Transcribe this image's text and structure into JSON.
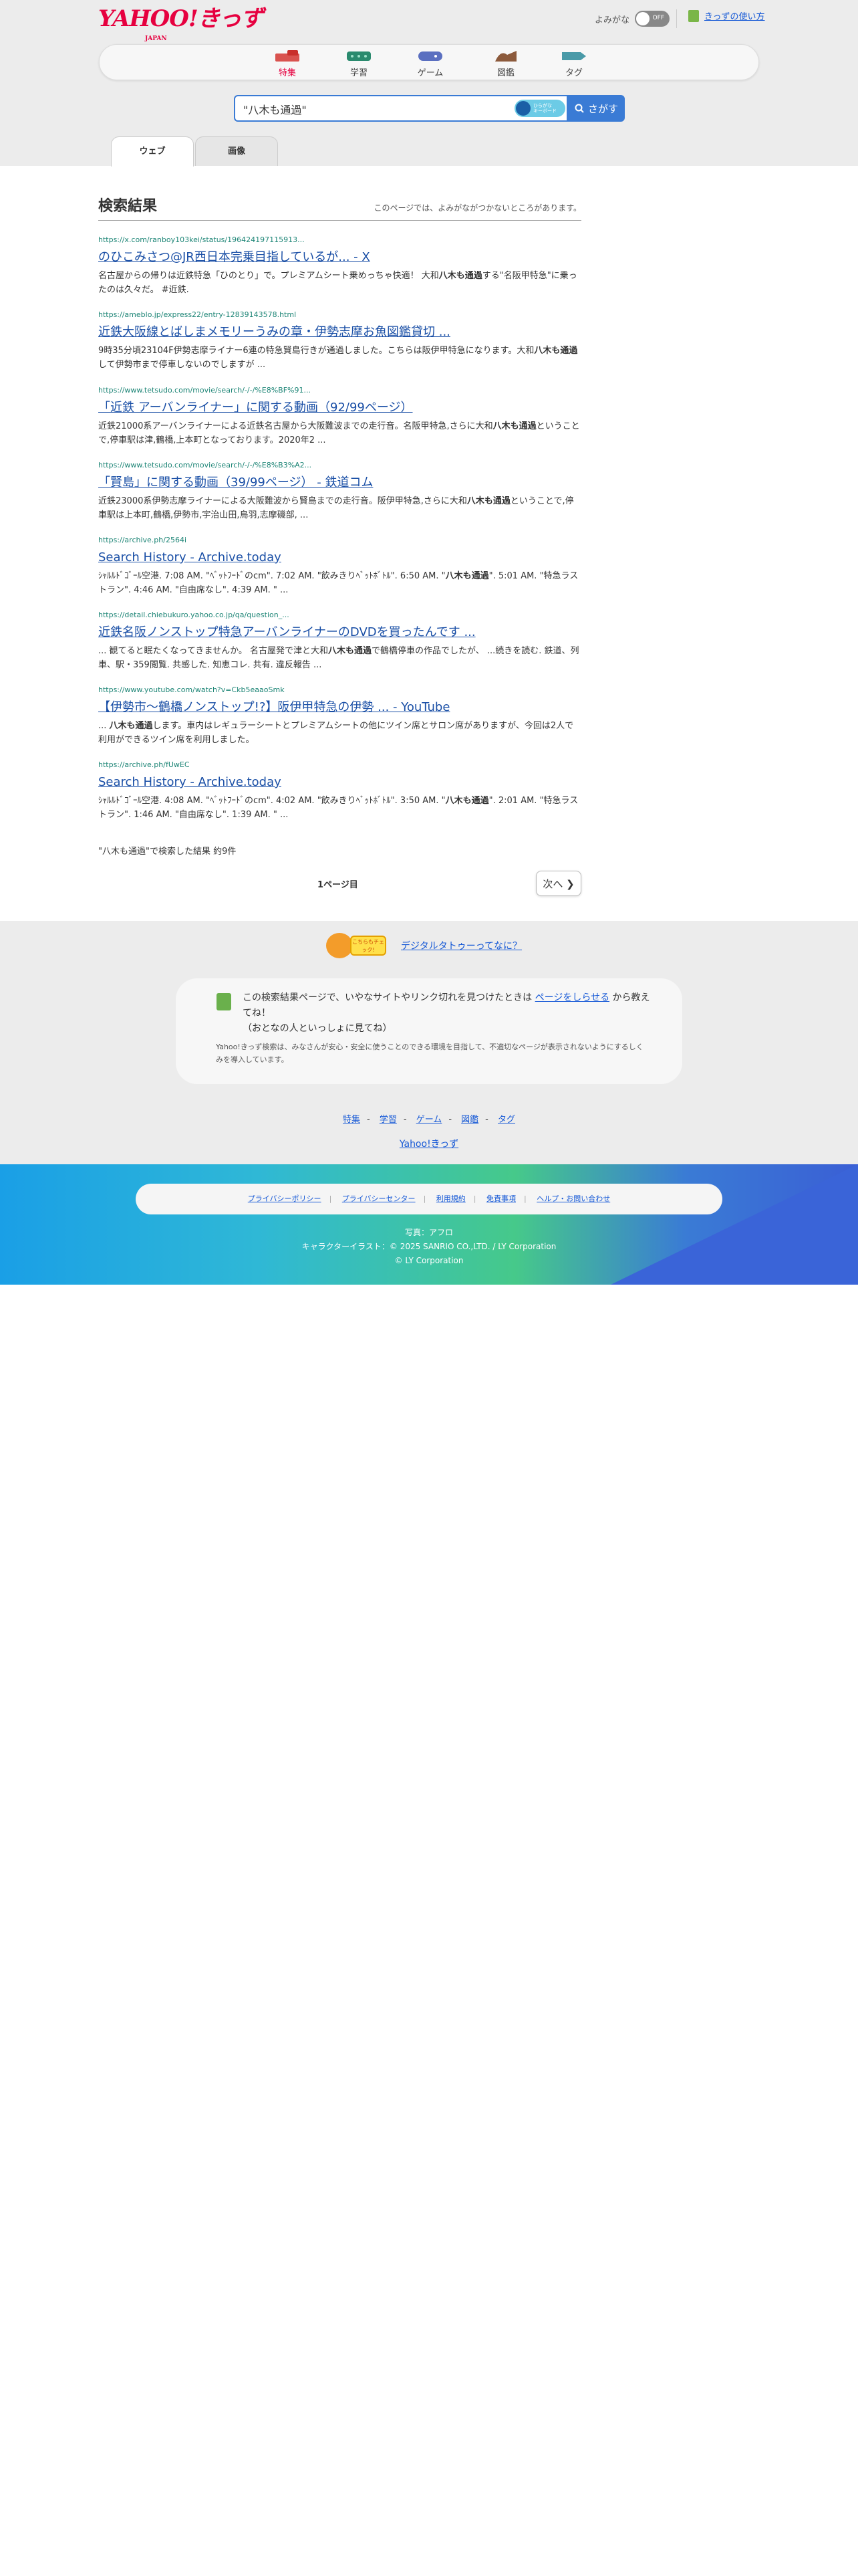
{
  "header": {
    "logo_text": "YAHOO!きっず",
    "logo_sub": "JAPAN",
    "yomigana_label": "よみがな",
    "toggle_state": "OFF",
    "howto_label": "きっずの使い方"
  },
  "nav": [
    {
      "label": "特集",
      "color": "#d9534f"
    },
    {
      "label": "学習",
      "color": "#2a8a6e"
    },
    {
      "label": "ゲーム",
      "color": "#5a6fc0"
    },
    {
      "label": "図鑑",
      "color": "#8c5a3c"
    },
    {
      "label": "タグ",
      "color": "#4a9aa8"
    }
  ],
  "search": {
    "query": "\"八木も通過\"",
    "keyboard_label": "ひらがな\nキーボード",
    "button_label": "さがす"
  },
  "tabs": [
    {
      "label": "ウェブ",
      "active": true
    },
    {
      "label": "画像",
      "active": false
    }
  ],
  "results_header": {
    "title": "検索結果",
    "note": "このページでは、よみがながつかないところがあります。"
  },
  "results": [
    {
      "url": "https://x.com/ranboy103kei/status/196424197115913...",
      "title": "のひこみさつ@JR西日本完乗目指しているが... - X",
      "snippet": "名古屋からの帰りは近鉄特急「ひのとり」で。プレミアムシート乗めっちゃ快適！ 大和八木も通過する\"名阪甲特急\"に乗ったのは久々だ。 #近鉄."
    },
    {
      "url": "https://ameblo.jp/express22/entry-12839143578.html",
      "title": "近鉄大阪線とばしまメモリーうみの章・伊勢志摩お魚図鑑貸切 ...",
      "snippet": "9時35分頃23104F伊勢志摩ライナー6連の特急賢島行きが通過しました。こちらは阪伊甲特急になります。大和八木も通過して伊勢市まで停車しないのでしますが ..."
    },
    {
      "url": "https://www.tetsudo.com/movie/search/-/-/%E8%BF%91...",
      "title": "「近鉄 アーバンライナー」に関する動画（92/99ページ）",
      "snippet": "近鉄21000系アーバンライナーによる近鉄名古屋から大阪難波までの走行音。名阪甲特急,さらに大和八木も通過ということで,停車駅は津,鶴橋,上本町となっております。2020年2 ..."
    },
    {
      "url": "https://www.tetsudo.com/movie/search/-/-/%E8%B3%A2...",
      "title": "「賢島」に関する動画（39/99ページ） - 鉄道コム",
      "snippet": "近鉄23000系伊勢志摩ライナーによる大阪難波から賢島までの走行音。阪伊甲特急,さらに大和八木も通過ということで,停車駅は上本町,鶴橋,伊勢市,宇治山田,鳥羽,志摩磯部, ..."
    },
    {
      "url": "https://archive.ph/2564i",
      "title": "Search History - Archive.today",
      "snippet": "ｼｬﾙﾙﾄﾞｺﾞｰﾙ空港. 7:08 AM. \"ﾍﾞｯﾄﾌｰﾄﾞのcm\". 7:02 AM. \"飲みきりﾍﾞｯﾄﾎﾞﾄﾙ\". 6:50 AM. \"八木も通過\". 5:01 AM. \"特急ラストラン\". 4:46 AM. \"自由席なし\". 4:39 AM. \" ..."
    },
    {
      "url": "https://detail.chiebukuro.yahoo.co.jp/qa/question_...",
      "title": "近鉄名阪ノンストップ特急アーバンライナーのDVDを買ったんです ...",
      "snippet": "... 観てると眠たくなってきませんか。 名古屋発で津と大和八木も通過で鶴橋停車の作品でしたが、 ...続きを読む. 鉄道、列車、駅・359閲覧. 共感した. 知恵コレ. 共有. 違反報告 ..."
    },
    {
      "url": "https://www.youtube.com/watch?v=Ckb5eaaoSmk",
      "title": "【伊勢市〜鶴橋ノンストップ!?】阪伊甲特急の伊勢 ... - YouTube",
      "snippet": "... 八木も通過します。車内はレギュラーシートとプレミアムシートの他にツイン席とサロン席がありますが、今回は2人で利用ができるツイン席を利用しました。"
    },
    {
      "url": "https://archive.ph/fUwEC",
      "title": "Search History - Archive.today",
      "snippet": "ｼｬﾙﾙﾄﾞｺﾞｰﾙ空港. 4:08 AM. \"ﾍﾞｯﾄﾌｰﾄﾞのcm\". 4:02 AM. \"飲みきりﾍﾞｯﾄﾎﾞﾄﾙ\". 3:50 AM. \"八木も通過\". 2:01 AM. \"特急ラストラン\". 1:46 AM. \"自由席なし\". 1:39 AM. \" ..."
    }
  ],
  "result_count": "\"八木も通過\"で検索した結果 約9件",
  "pager": {
    "page_label": "1ページ目",
    "next_label": "次へ"
  },
  "digital_tattoo": {
    "badge": "こちらもチェック!",
    "link": "デジタルタトゥーってなに？"
  },
  "report": {
    "message_pre": "この検索結果ページで、いやなサイトやリンク切れを見つけたときは",
    "link": "ページをしらせる",
    "message_post": "から教えてね！",
    "message_line2": "（おとなの人といっしょに見てね）",
    "sub": "Yahoo!きっず検索は、みなさんが安心・安全に使うことのできる環境を目指して、不適切なページが表示されないようにするしくみを導入しています。"
  },
  "footer_nav": [
    "特集",
    "学習",
    "ゲーム",
    "図鑑",
    "タグ"
  ],
  "footer_home": "Yahoo!きっず",
  "footer_links": [
    "プライバシーポリシー",
    "プライバシーセンター",
    "利用規約",
    "免責事項",
    "ヘルプ・お問い合わせ"
  ],
  "credits": [
    "写真：アフロ",
    "キャラクターイラスト：© 2025 SANRIO CO.,LTD. / LY Corporation",
    "© LY Corporation"
  ]
}
